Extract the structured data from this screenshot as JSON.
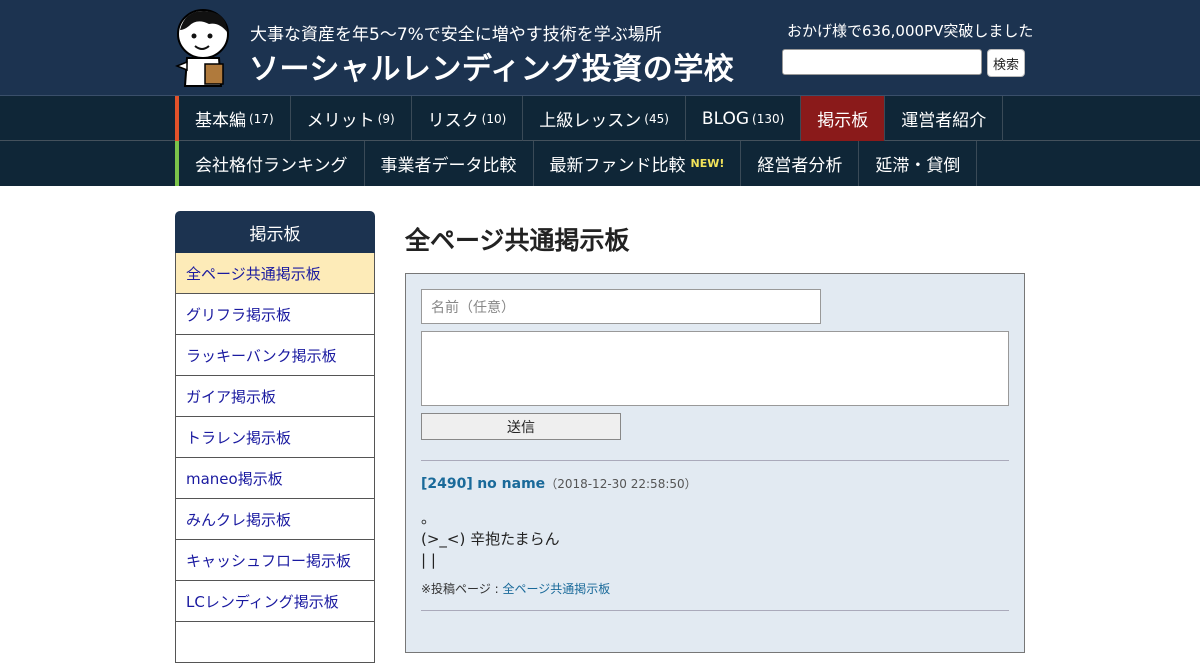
{
  "header": {
    "tagline": "大事な資産を年5～7%で安全に増やす技術を学ぶ場所",
    "site_title": "ソーシャルレンディング投資の学校",
    "pv_text": "おかげ様で636,000PV突破しました",
    "search_placeholder": "",
    "search_button": "検索"
  },
  "nav_primary": [
    {
      "label": "基本編",
      "count": "(17)"
    },
    {
      "label": "メリット",
      "count": "(9)"
    },
    {
      "label": "リスク",
      "count": "(10)"
    },
    {
      "label": "上級レッスン",
      "count": "(45)"
    },
    {
      "label": "BLOG",
      "count": "(130)"
    },
    {
      "label": "掲示板",
      "count": ""
    },
    {
      "label": "運営者紹介",
      "count": ""
    }
  ],
  "nav_secondary": [
    {
      "label": "会社格付ランキング",
      "badge": ""
    },
    {
      "label": "事業者データ比較",
      "badge": ""
    },
    {
      "label": "最新ファンド比較",
      "badge": "NEW!"
    },
    {
      "label": "経営者分析",
      "badge": ""
    },
    {
      "label": "延滞・貸倒",
      "badge": ""
    }
  ],
  "sidebar": {
    "title": "掲示板",
    "items": [
      "全ページ共通掲示板",
      "グリフラ掲示板",
      "ラッキーバンク掲示板",
      "ガイア掲示板",
      "トラレン掲示板",
      "maneo掲示板",
      "みんクレ掲示板",
      "キャッシュフロー掲示板",
      "LCレンディング掲示板"
    ]
  },
  "main": {
    "title": "全ページ共通掲示板",
    "form": {
      "name_placeholder": "名前（任意）",
      "message_value": "",
      "submit_label": "送信"
    },
    "posts": [
      {
        "id": "[2490]",
        "name": "no name",
        "date": "（2018-12-30 22:58:50）",
        "lines": [
          "。",
          "(>_<) 辛抱たまらん",
          "| |"
        ],
        "source_prefix": "※投稿ページ : ",
        "source_link": "全ページ共通掲示板"
      }
    ]
  },
  "colors": {
    "header_bg": "#1c3350",
    "nav_bg": "#0f2637",
    "nav_active": "#8a1a1a",
    "nav1_accent": "#e2522a",
    "nav2_accent": "#7bc34a",
    "sidebar_current": "#fdebb8",
    "board_bg": "#e2eaf2",
    "link": "#1a6a9a"
  }
}
